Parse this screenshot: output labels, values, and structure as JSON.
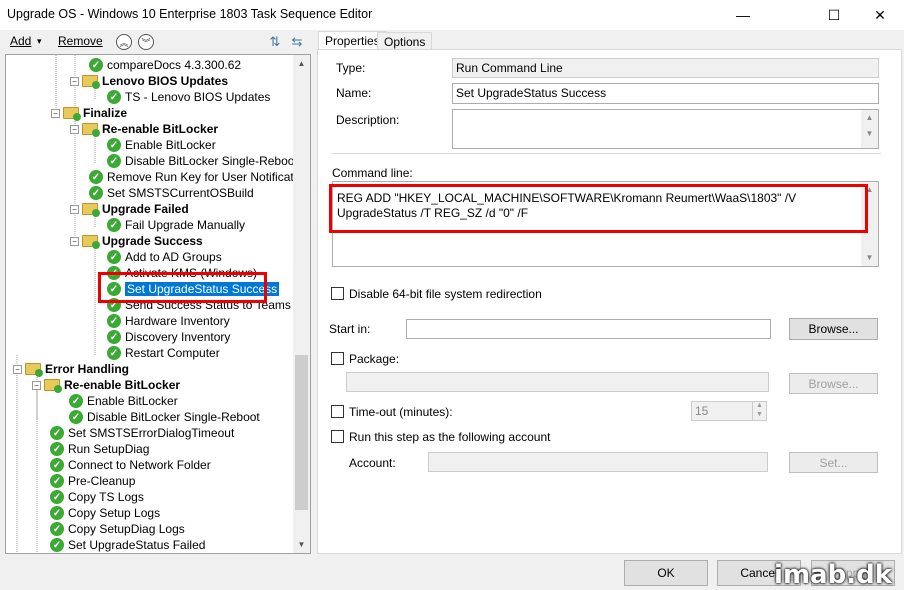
{
  "window": {
    "title": "Upgrade OS - Windows 10 Enterprise 1803 Task Sequence Editor",
    "minimize": "—",
    "maximize": "☐",
    "close": "✕"
  },
  "toolbar": {
    "add_label": "Add",
    "add_caret": "▾",
    "remove_label": "Remove",
    "move_up": "︽",
    "move_down": "︾"
  },
  "tree": {
    "items": [
      {
        "label": "compareDocs 4.3.300.62",
        "type": "step"
      },
      {
        "label": "Lenovo BIOS Updates",
        "type": "group"
      },
      {
        "label": "TS - Lenovo BIOS Updates",
        "type": "step"
      },
      {
        "label": "Finalize",
        "type": "group"
      },
      {
        "label": "Re-enable BitLocker",
        "type": "group"
      },
      {
        "label": "Enable BitLocker",
        "type": "step"
      },
      {
        "label": "Disable BitLocker Single-Reboot",
        "type": "step"
      },
      {
        "label": "Remove Run Key for User Notification",
        "type": "step"
      },
      {
        "label": "Set SMSTSCurrentOSBuild",
        "type": "step"
      },
      {
        "label": "Upgrade Failed",
        "type": "group"
      },
      {
        "label": "Fail Upgrade Manually",
        "type": "step"
      },
      {
        "label": "Upgrade Success",
        "type": "group"
      },
      {
        "label": "Add to AD Groups",
        "type": "step"
      },
      {
        "label": "Activate KMS (Windows)",
        "type": "step"
      },
      {
        "label": "Set UpgradeStatus Success",
        "type": "step",
        "selected": true
      },
      {
        "label": "Send Success Status to Teams",
        "type": "step"
      },
      {
        "label": "Hardware Inventory",
        "type": "step"
      },
      {
        "label": "Discovery Inventory",
        "type": "step"
      },
      {
        "label": "Restart Computer",
        "type": "step"
      },
      {
        "label": "Error Handling",
        "type": "group"
      },
      {
        "label": "Re-enable BitLocker",
        "type": "group"
      },
      {
        "label": "Enable BitLocker",
        "type": "step"
      },
      {
        "label": "Disable BitLocker Single-Reboot",
        "type": "step"
      },
      {
        "label": "Set SMSTSErrorDialogTimeout",
        "type": "step"
      },
      {
        "label": "Run SetupDiag",
        "type": "step"
      },
      {
        "label": "Connect to Network Folder",
        "type": "step"
      },
      {
        "label": "Pre-Cleanup",
        "type": "step"
      },
      {
        "label": "Copy TS Logs",
        "type": "step"
      },
      {
        "label": "Copy Setup Logs",
        "type": "step"
      },
      {
        "label": "Copy SetupDiag Logs",
        "type": "step"
      },
      {
        "label": "Set UpgradeStatus Failed",
        "type": "step"
      }
    ]
  },
  "tabs": [
    "Properties",
    "Options"
  ],
  "properties": {
    "type_label": "Type:",
    "type_value": "Run Command Line",
    "name_label": "Name:",
    "name_value": "Set UpgradeStatus Success",
    "description_label": "Description:",
    "description_value": "",
    "command_line_label": "Command line:",
    "command_line_value": "REG ADD \"HKEY_LOCAL_MACHINE\\SOFTWARE\\Kromann Reumert\\WaaS\\1803\" /V UpgradeStatus /T REG_SZ /d \"0\" /F",
    "disable64_label": "Disable 64-bit file system redirection",
    "start_in_label": "Start in:",
    "start_in_value": "",
    "browse_label": "Browse...",
    "package_label": "Package:",
    "package_value": "",
    "package_browse_label": "Browse...",
    "timeout_label": "Time-out (minutes):",
    "timeout_value": "15",
    "run_as_label": "Run this step as the following account",
    "account_label": "Account:",
    "account_value": "",
    "set_label": "Set..."
  },
  "footer": {
    "ok_label": "OK",
    "cancel_label": "Cancel",
    "apply_label": "Apply"
  },
  "watermark": "imab.dk",
  "colors": {
    "selection": "#0078d7",
    "highlight_box": "#e00000",
    "success_check": "#3aaa35"
  }
}
